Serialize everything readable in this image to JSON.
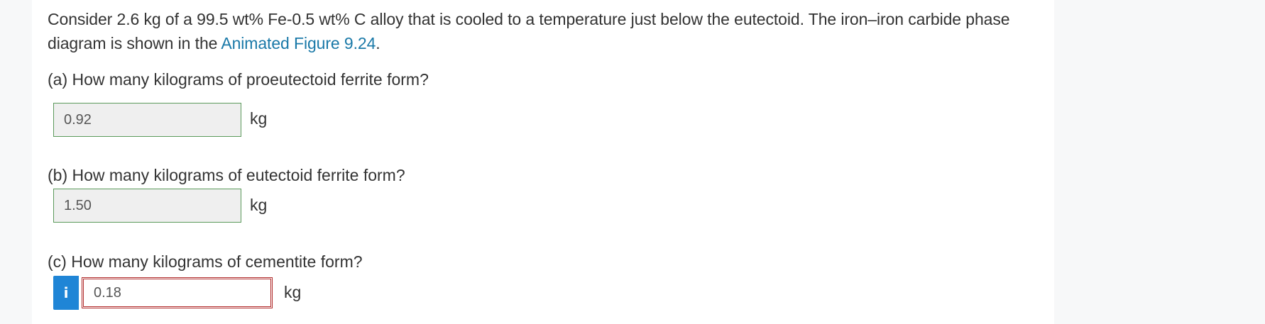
{
  "question": {
    "text_prefix": "Consider 2.6 kg of a 99.5 wt% Fe-0.5 wt% C alloy that is cooled to a temperature just below the eutectoid. The iron–iron carbide phase diagram is shown in the",
    "link_text": "Animated Figure 9.24",
    "text_suffix": "."
  },
  "parts": [
    {
      "label": "(a) How many kilograms of proeutectoid ferrite form?",
      "value": "0.92",
      "unit": "kg",
      "status": "correct"
    },
    {
      "label": "(b) How many kilograms of eutectoid ferrite form?",
      "value": "1.50",
      "unit": "kg",
      "status": "correct"
    },
    {
      "label": "(c) How many kilograms of cementite form?",
      "value": "0.18",
      "unit": "kg",
      "status": "incorrect"
    }
  ],
  "icons": {
    "info": "info-icon"
  },
  "colors": {
    "link": "#1a79a8",
    "correct_border": "#5b9a5b",
    "incorrect_border": "#b02a2a",
    "info_button": "#1f85d6"
  }
}
